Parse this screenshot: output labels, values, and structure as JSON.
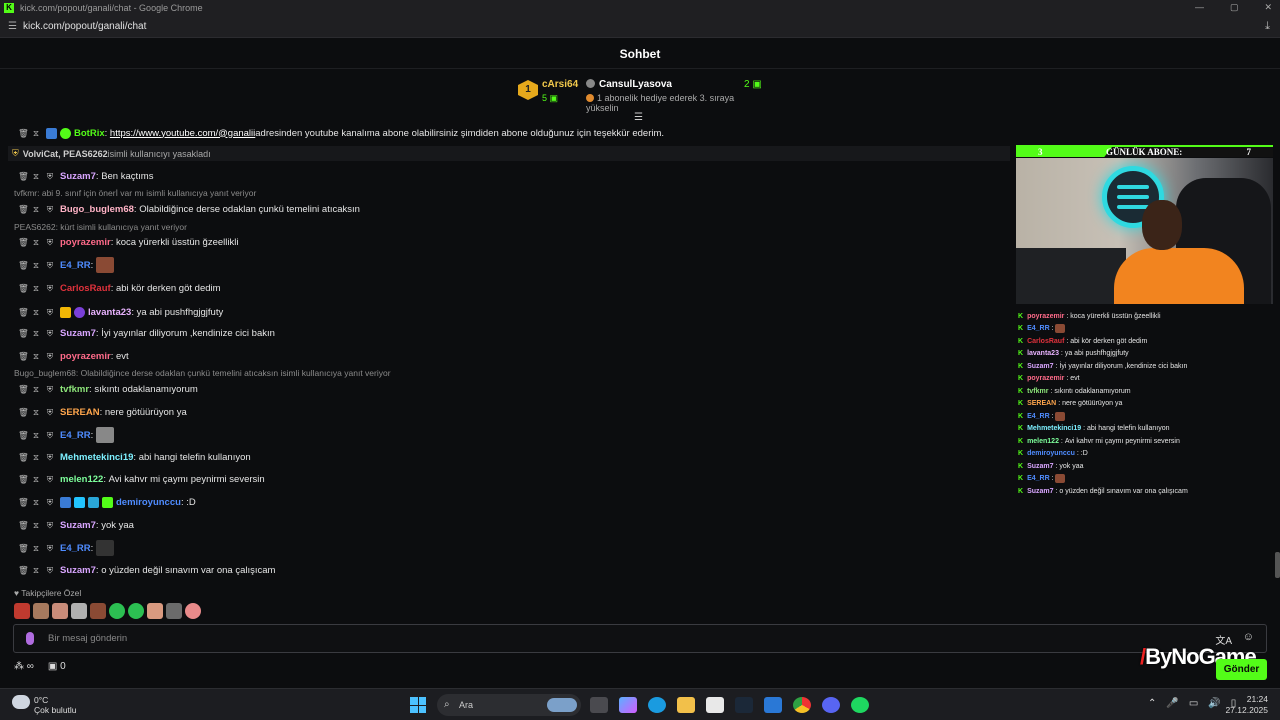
{
  "window": {
    "title": "kick.com/popout/ganali/chat - Google Chrome",
    "url": "kick.com/popout/ganali/chat"
  },
  "header": {
    "title": "Sohbet"
  },
  "gifter": {
    "rank": "1",
    "top_name": "cArsi64",
    "top_count": "5",
    "user": "CansulLyasova",
    "user_count": "2",
    "message": "1 abonelik hediye ederek 3. sıraya yükselin"
  },
  "colors": {
    "kick_green": "#53fc18",
    "background": "#0c0d0f"
  },
  "chat": {
    "botrix": {
      "user": "BotRix",
      "link": "https://www.youtube.com/@ganalii",
      "text": " adresinden youtube kanalıma abone olabilirsiniz şimdiden abone olduğunuz için teşekkür ederim."
    },
    "ban": {
      "users": "VolviCat, PEAS6262",
      "text": " isimli kullanıcıyı yasakladı"
    },
    "messages": [
      {
        "user": "Suzam7",
        "text": "Ben kaçtıms",
        "color": "#d9a6ff"
      },
      {
        "reply": "tvfkmr: abi 9. sınıf için önerİ var mı isimli kullanıcıya yanıt veriyor"
      },
      {
        "user": "Bugo_buglem68",
        "text": "Olabildiğince derse odaklan çunkü temelini atıcaksın",
        "color": "#ffb3c6"
      },
      {
        "reply": "PEAS6262: kürt isimli kullanıcıya yanıt veriyor"
      },
      {
        "user": "poyrazemir",
        "text": "koca yürerkli üsstün ğzeellikli",
        "color": "#ff6b8a"
      },
      {
        "user": "E4_RR",
        "text": "",
        "color": "#4f8cff"
      },
      {
        "user": "CarlosRauf",
        "text": "abi kör derken göt dedim",
        "color": "#e0323c"
      },
      {
        "user": "lavanta23",
        "text": "ya abi pushfhgjgjfuty",
        "color": "#e9b3ff"
      },
      {
        "user": "Suzam7",
        "text": "İyi yayınlar diliyorum ,kendinize cici bakın",
        "color": "#d9a6ff"
      },
      {
        "user": "poyrazemir",
        "text": "evt",
        "color": "#ff6b8a"
      },
      {
        "reply": "Bugo_buglem68: Olabildiğince derse odaklan çunkü temelini atıcaksın isimli kullanıcıya yanıt veriyor"
      },
      {
        "user": "tvfkmr",
        "text": "sıkıntı odaklanamıyorum",
        "color": "#8de57a"
      },
      {
        "user": "SEREAN",
        "text": "nere götüürüyon ya",
        "color": "#ffa64d"
      },
      {
        "user": "E4_RR",
        "text": "",
        "color": "#4f8cff"
      },
      {
        "user": "Mehmetekinci19",
        "text": "abi hangi telefin kullanıyon",
        "color": "#7df0ff"
      },
      {
        "user": "melen122",
        "text": "Avi kahvr mi çaymı peynirmi seversin",
        "color": "#7dff9b"
      },
      {
        "user": "demiroyunccu",
        "text": ":D",
        "color": "#4f8cff"
      },
      {
        "user": "Suzam7",
        "text": "yok yaa",
        "color": "#d9a6ff"
      },
      {
        "user": "E4_RR",
        "text": "",
        "color": "#4f8cff"
      },
      {
        "user": "Suzam7",
        "text": "o yüzden değil sınavım var ona çalışıcam",
        "color": "#d9a6ff"
      }
    ]
  },
  "follower_emotes": {
    "label": "Takipçilere Özel"
  },
  "input": {
    "placeholder": "Bir mesaj gönderin"
  },
  "bottom": {
    "points": "∞",
    "gift_count": "0",
    "send_label": "Gönder"
  },
  "watermark": "ByNoGame",
  "overlay": {
    "banner_left": "3",
    "banner_title": "GÜNLÜK ABONE:",
    "banner_right": "7",
    "chat": [
      {
        "user": "poyrazemir",
        "text": "koca yürerkli üsstün ğzeellikli",
        "color": "#ff6b8a"
      },
      {
        "user": "E4_RR",
        "text": "",
        "color": "#4f8cff"
      },
      {
        "user": "CarlosRauf",
        "text": "abi kör derken göt dedim",
        "color": "#e0323c"
      },
      {
        "user": "lavanta23",
        "text": "ya abi pushfhgjgjfuty",
        "color": "#e9b3ff"
      },
      {
        "user": "Suzam7",
        "text": "İyi yayınlar diliyorum ,kendinize cici bakın",
        "color": "#d9a6ff"
      },
      {
        "user": "poyrazemir",
        "text": "evt",
        "color": "#ff6b8a"
      },
      {
        "user": "tvfkmr",
        "text": "sıkıntı odaklanamıyorum",
        "color": "#8de57a"
      },
      {
        "user": "SEREAN",
        "text": "nere götüürüyon ya",
        "color": "#ffa64d"
      },
      {
        "user": "E4_RR",
        "text": "",
        "color": "#4f8cff"
      },
      {
        "user": "Mehmetekinci19",
        "text": "abi hangi telefin kullanıyon",
        "color": "#7df0ff"
      },
      {
        "user": "melen122",
        "text": "Avi kahvr mi çaymı peynirmi seversin",
        "color": "#7dff9b"
      },
      {
        "user": "demiroyunccu",
        "text": ":D",
        "color": "#4f8cff"
      },
      {
        "user": "Suzam7",
        "text": "yok yaa",
        "color": "#d9a6ff"
      },
      {
        "user": "E4_RR",
        "text": "",
        "color": "#4f8cff"
      },
      {
        "user": "Suzam7",
        "text": "o yüzden değil sınavım var ona çalışıcam",
        "color": "#d9a6ff"
      }
    ]
  },
  "taskbar": {
    "temp": "0°C",
    "weather": "Çok bulutlu",
    "search": "Ara",
    "time": "21:24",
    "date": "27.12.2025"
  }
}
